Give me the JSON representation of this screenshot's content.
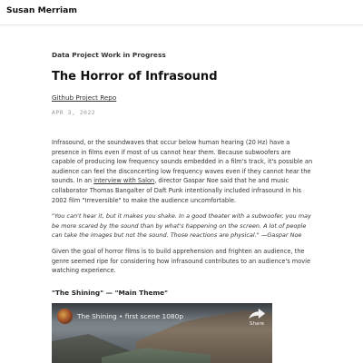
{
  "site": {
    "title": "Susan Merriam"
  },
  "post": {
    "category": "Data Project Work in Progress",
    "title": "The Horror of Infrasound",
    "repo_link": "Github Project Repo",
    "date": "APR 3, 2022",
    "p1_before": "Infrasound, or the soundwaves that occur below human hearing (20 Hz) have a presence in films even if most of us cannot hear them. Because subwoofers are capable of producing low frequency sounds embedded in a film's track, it's possible an audience can feel the disconcerting low frequency waves even if they cannot hear the sounds. In an ",
    "p1_link": "interview with Salon",
    "p1_after": ", director Gaspar Noe said that he and music collaborator Thomas Bangalter of Daft Punk intentionally included infrasound in his 2002 film \"Irreversible\" to make the audience uncomfortable.",
    "quote": "\"You can't hear it, but it makes you shake. In a good theater with a subwoofer, you may be more scared by the sound than by what's happening on the screen. A lot of people can take the images but not the sound. Those reactions are physical.\" —Gaspar Noe",
    "p2": "Given the goal of horror films is to build apprehension and frighten an audience, the genre seemed ripe for considering how infrasound contributes to an audience's movie watching experience.",
    "section_heading": "\"The Shining\" — \"Main Theme\""
  },
  "video": {
    "title": "The Shining • first scene 1080p",
    "share_label": "Share",
    "icons": [
      "channel-avatar",
      "share-icon"
    ]
  }
}
